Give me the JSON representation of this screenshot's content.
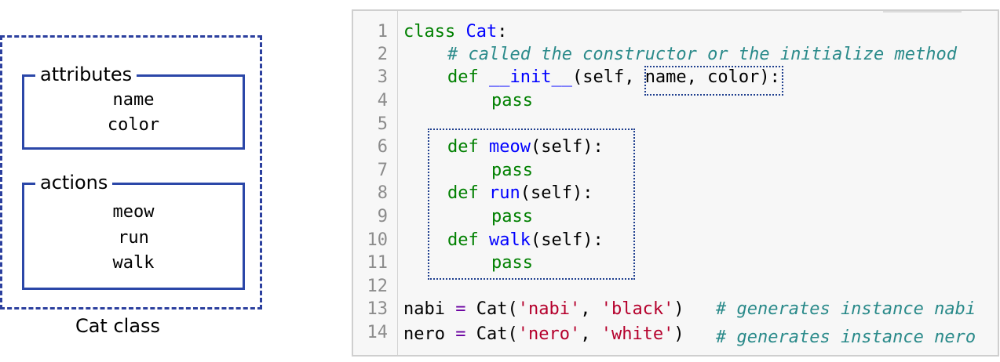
{
  "class_diagram": {
    "attributes": {
      "title": "attributes",
      "items": [
        "name",
        "color"
      ]
    },
    "actions": {
      "title": "actions",
      "items": [
        "meow",
        "run",
        "walk"
      ]
    },
    "caption": "Cat class"
  },
  "code": {
    "line_numbers": [
      "1",
      "2",
      "3",
      "4",
      "5",
      "6",
      "7",
      "8",
      "9",
      "10",
      "11",
      "12",
      "13",
      "14"
    ],
    "tokens": {
      "class_kw": "class",
      "class_name": "Cat",
      "colon": ":",
      "comment_constructor": "# called the constructor or the initialize method",
      "def_kw": "def",
      "init_name": "__init__",
      "init_self": "(self, ",
      "init_params": "name, color)",
      "pass_kw": "pass",
      "meow_name": "meow",
      "run_name": "run",
      "walk_name": "walk",
      "self_paren": "(self):",
      "var_nabi": "nabi",
      "var_nero": "nero",
      "assign": " = ",
      "call_cat_open": "Cat(",
      "str_nabi": "'nabi'",
      "str_black": "'black'",
      "str_nero": "'nero'",
      "str_white": "'white'",
      "comma": ", ",
      "close_paren": ")",
      "comment_nabi": "# generates instance nabi",
      "comment_nero": "# generates instance nero"
    }
  },
  "colors": {
    "diagram_border": "#2b47a8",
    "keyword": "#008000",
    "function_name": "#0000ff",
    "string": "#b5002c",
    "comment": "#2a8a8a",
    "line_number": "#8c8c8c"
  }
}
